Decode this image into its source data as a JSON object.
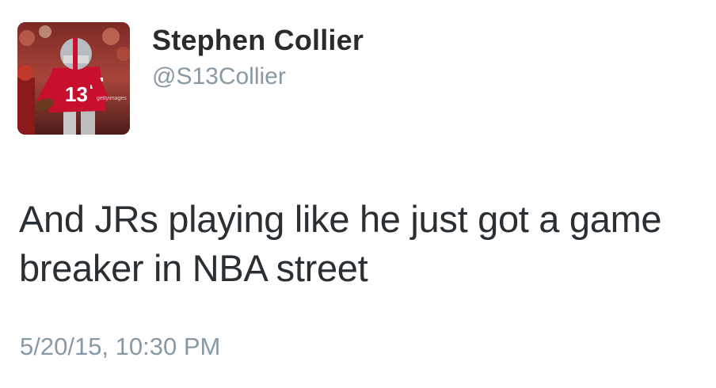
{
  "tweet": {
    "author": {
      "name": "Stephen Collier",
      "handle": "@S13Collier",
      "avatar": {
        "icon": "profile-photo-football-player",
        "watermark": "gettyimages",
        "jersey_number": "13"
      }
    },
    "text": "And JRs playing like he just got a game breaker in NBA street",
    "timestamp": "5/20/15, 10:30 PM"
  },
  "colors": {
    "name": "#2b2b2b",
    "text": "#292f33",
    "muted": "#8899a6",
    "jersey": "#c8102e",
    "background": "#ffffff"
  }
}
